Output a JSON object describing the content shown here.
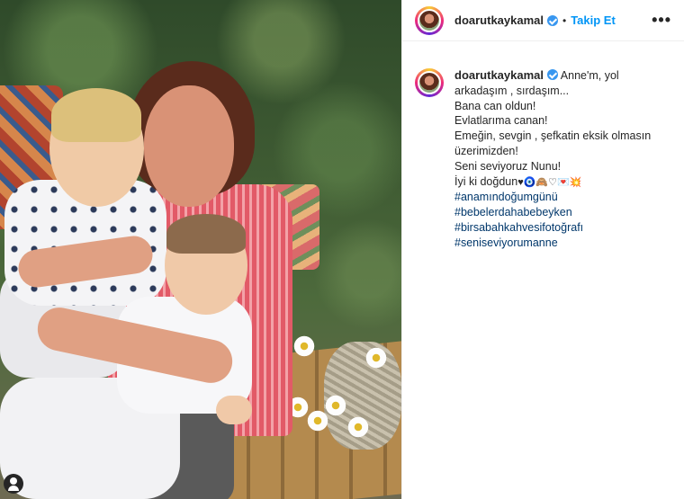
{
  "post": {
    "username": "doarutkaykamal",
    "follow_label": "Takip Et",
    "separator": "•",
    "more_label": "•••"
  },
  "caption": {
    "username": "doarutkaykamal",
    "first_text": " Anne'm, yol arkadaşım , sırdaşım...",
    "lines": [
      "Bana can oldun!",
      "Evlatlarıma canan!",
      "Emeğin, sevgin , şefkatin eksik olmasın üzerimizden!",
      "Seni seviyoruz Nunu!"
    ],
    "last_line": "İyi ki doğdun",
    "emojis": "♥🧿🙈♡💌💥",
    "hashtags": [
      "#anamındoğumgünü",
      "#bebelerdahabebeyken",
      "#birsabahkahvesifotoğrafı",
      "#seniseviyorumanne"
    ]
  },
  "colors": {
    "link": "#0095f6",
    "hashtag": "#00376b",
    "verified": "#3897f0"
  },
  "icons": {
    "verified": "verified-badge-icon",
    "tag": "user-tag-icon"
  }
}
